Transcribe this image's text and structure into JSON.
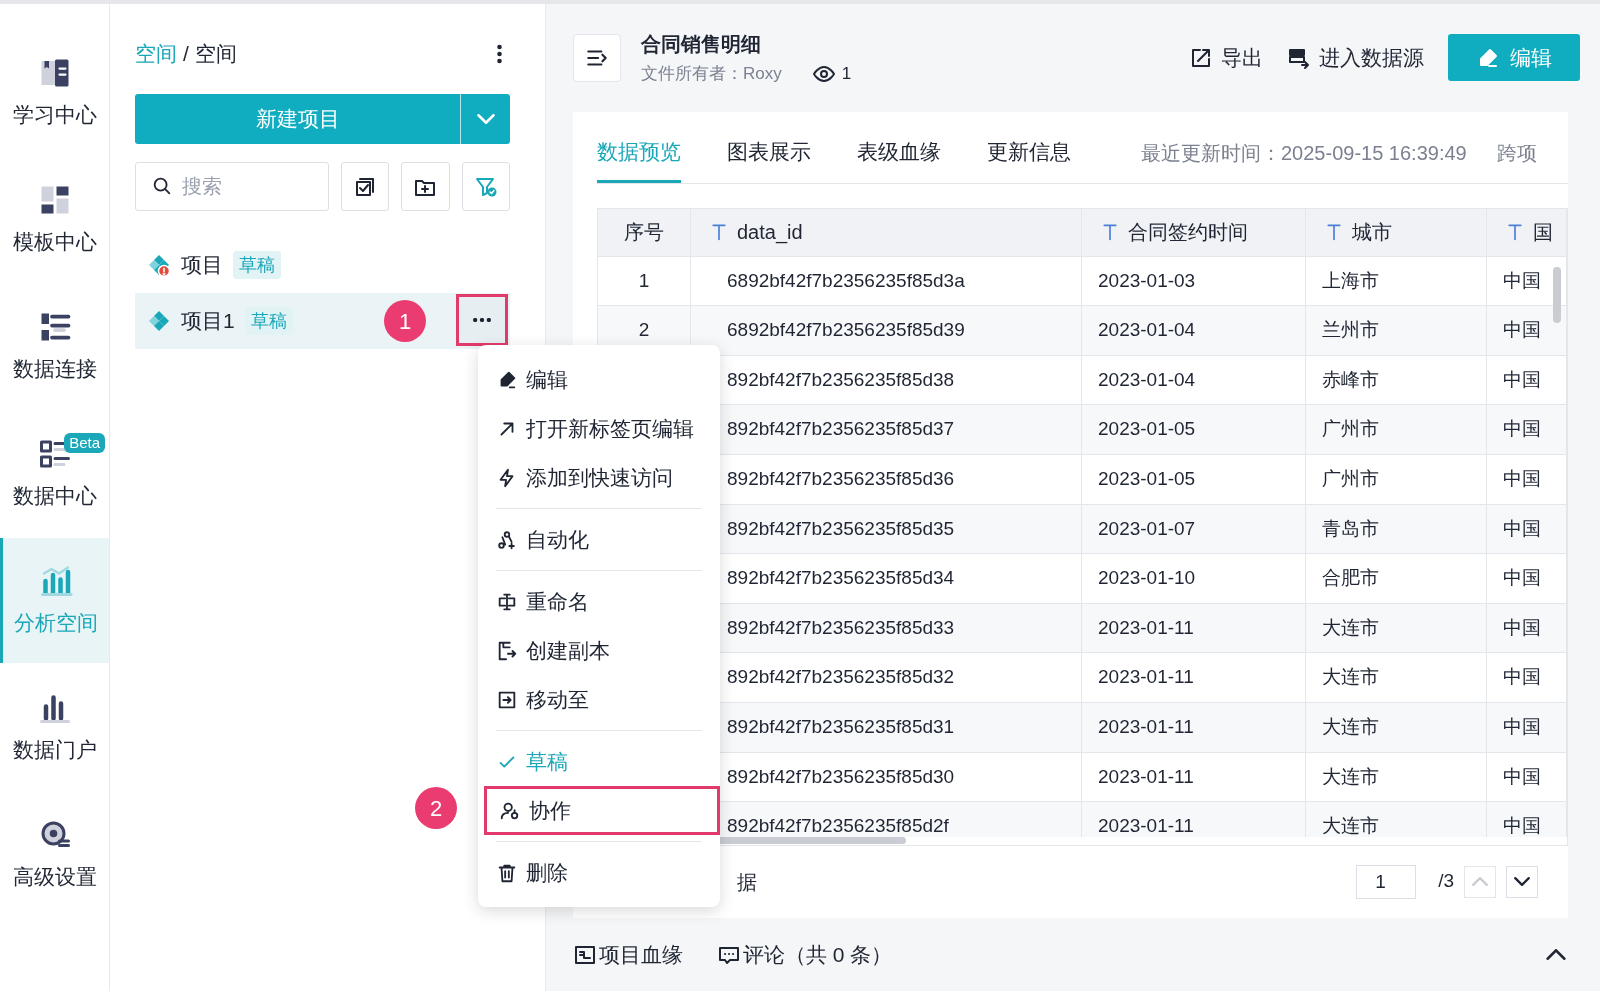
{
  "nav": [
    {
      "label": "学习中心",
      "selected": false
    },
    {
      "label": "模板中心",
      "selected": false
    },
    {
      "label": "数据连接",
      "selected": false
    },
    {
      "label": "数据中心",
      "selected": false,
      "badge": "Beta"
    },
    {
      "label": "分析空间",
      "selected": true
    },
    {
      "label": "数据门户",
      "selected": false
    },
    {
      "label": "高级设置",
      "selected": false
    }
  ],
  "breadcrumb": {
    "parent": "空间",
    "separator": "/",
    "current": "空间"
  },
  "new_button": "新建项目",
  "search": {
    "placeholder": "搜索"
  },
  "projects": [
    {
      "name": "项目",
      "tag": "草稿",
      "warning": true,
      "selected": false
    },
    {
      "name": "项目1",
      "tag": "草稿",
      "warning": false,
      "selected": true
    }
  ],
  "steps": [
    "1",
    "2"
  ],
  "header": {
    "title": "合同销售明细",
    "owner": "文件所有者：Roxy",
    "views": "1",
    "export": "导出",
    "source": "进入数据源",
    "edit": "编辑"
  },
  "tabs": [
    {
      "label": "数据预览",
      "selected": true
    },
    {
      "label": "图表展示",
      "selected": false
    },
    {
      "label": "表级血缘",
      "selected": false
    },
    {
      "label": "更新信息",
      "selected": false
    }
  ],
  "updated": "最近更新时间：2025-09-15 16:39:49",
  "cut_tab": "跨项",
  "table": {
    "columns": [
      {
        "label": "序号",
        "typed": false
      },
      {
        "label": "data_id",
        "typed": true
      },
      {
        "label": "合同签约时间",
        "typed": true
      },
      {
        "label": "城市",
        "typed": true
      },
      {
        "label": "国",
        "typed": true
      }
    ],
    "rows": [
      {
        "index": "1",
        "data_id": "6892bf42f7b2356235f85d3a",
        "date": "2023-01-03",
        "city": "上海市",
        "country": "中国"
      },
      {
        "index": "2",
        "data_id": "6892bf42f7b2356235f85d39",
        "date": "2023-01-04",
        "city": "兰州市",
        "country": "中国"
      },
      {
        "data_id": "892bf42f7b2356235f85d38",
        "date": "2023-01-04",
        "city": "赤峰市",
        "country": "中国"
      },
      {
        "data_id": "892bf42f7b2356235f85d37",
        "date": "2023-01-05",
        "city": "广州市",
        "country": "中国"
      },
      {
        "data_id": "892bf42f7b2356235f85d36",
        "date": "2023-01-05",
        "city": "广州市",
        "country": "中国"
      },
      {
        "data_id": "892bf42f7b2356235f85d35",
        "date": "2023-01-07",
        "city": "青岛市",
        "country": "中国"
      },
      {
        "data_id": "892bf42f7b2356235f85d34",
        "date": "2023-01-10",
        "city": "合肥市",
        "country": "中国"
      },
      {
        "data_id": "892bf42f7b2356235f85d33",
        "date": "2023-01-11",
        "city": "大连市",
        "country": "中国"
      },
      {
        "data_id": "892bf42f7b2356235f85d32",
        "date": "2023-01-11",
        "city": "大连市",
        "country": "中国"
      },
      {
        "data_id": "892bf42f7b2356235f85d31",
        "date": "2023-01-11",
        "city": "大连市",
        "country": "中国"
      },
      {
        "data_id": "892bf42f7b2356235f85d30",
        "date": "2023-01-11",
        "city": "大连市",
        "country": "中国"
      },
      {
        "data_id": "892bf42f7b2356235f85d2f",
        "date": "2023-01-11",
        "city": "大连市",
        "country": "中国"
      }
    ]
  },
  "pagination": {
    "count_text": "据",
    "page": "1",
    "total": "/3"
  },
  "footer": {
    "lineage": "项目血缘",
    "comments": "评论（共 0 条）"
  },
  "menu": [
    {
      "kind": "item",
      "label": "编辑"
    },
    {
      "kind": "item",
      "label": "打开新标签页编辑"
    },
    {
      "kind": "item",
      "label": "添加到快速访问"
    },
    {
      "kind": "divider"
    },
    {
      "kind": "item",
      "label": "自动化"
    },
    {
      "kind": "divider"
    },
    {
      "kind": "item",
      "label": "重命名"
    },
    {
      "kind": "item",
      "label": "创建副本"
    },
    {
      "kind": "item",
      "label": "移动至"
    },
    {
      "kind": "divider"
    },
    {
      "kind": "check",
      "label": "草稿",
      "checked": true
    },
    {
      "kind": "item",
      "label": "协作",
      "highlighted": true
    },
    {
      "kind": "divider"
    },
    {
      "kind": "item",
      "label": "删除"
    }
  ]
}
